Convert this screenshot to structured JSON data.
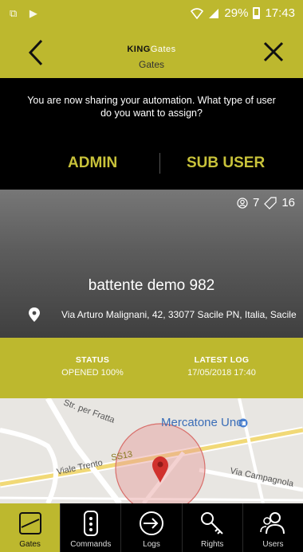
{
  "status_bar": {
    "left_icons": "⧉ ▶",
    "battery": "29%",
    "time": "17:43",
    "signal": "📶"
  },
  "header": {
    "brand_bold": "KING",
    "brand_thin": "Gates",
    "subtitle": "Gates"
  },
  "share": {
    "message": "You are now sharing your automation. What type of user do you want to assign?",
    "admin_label": "ADMIN",
    "sub_user_label": "SUB USER"
  },
  "device": {
    "users_count": "7",
    "keys_count": "16",
    "name": "battente demo 982",
    "address": "Via Arturo Malignani, 42, 33077 Sacile PN, Italia, Sacile"
  },
  "status_row": {
    "status_label": "STATUS",
    "status_value": "OPENED 100%",
    "log_label": "LATEST LOG",
    "log_value": "17/05/2018 17:40"
  },
  "map": {
    "labels": {
      "str_per_fratta": "Str. per Fratta",
      "mercatone": "Mercatone Uno",
      "ss13": "SS13",
      "viale_trento": "Viale Trento",
      "via_campagnola": "Via Campagnola"
    }
  },
  "nav": {
    "tabs": [
      {
        "label": "Gates",
        "icon": "gates-icon"
      },
      {
        "label": "Commands",
        "icon": "remote-icon"
      },
      {
        "label": "Logs",
        "icon": "logs-icon"
      },
      {
        "label": "Rights",
        "icon": "key-icon"
      },
      {
        "label": "Users",
        "icon": "users-icon"
      }
    ]
  },
  "colors": {
    "accent": "#bdb82e",
    "share_button": "#c8c23a",
    "map_pin": "#d0312d"
  }
}
